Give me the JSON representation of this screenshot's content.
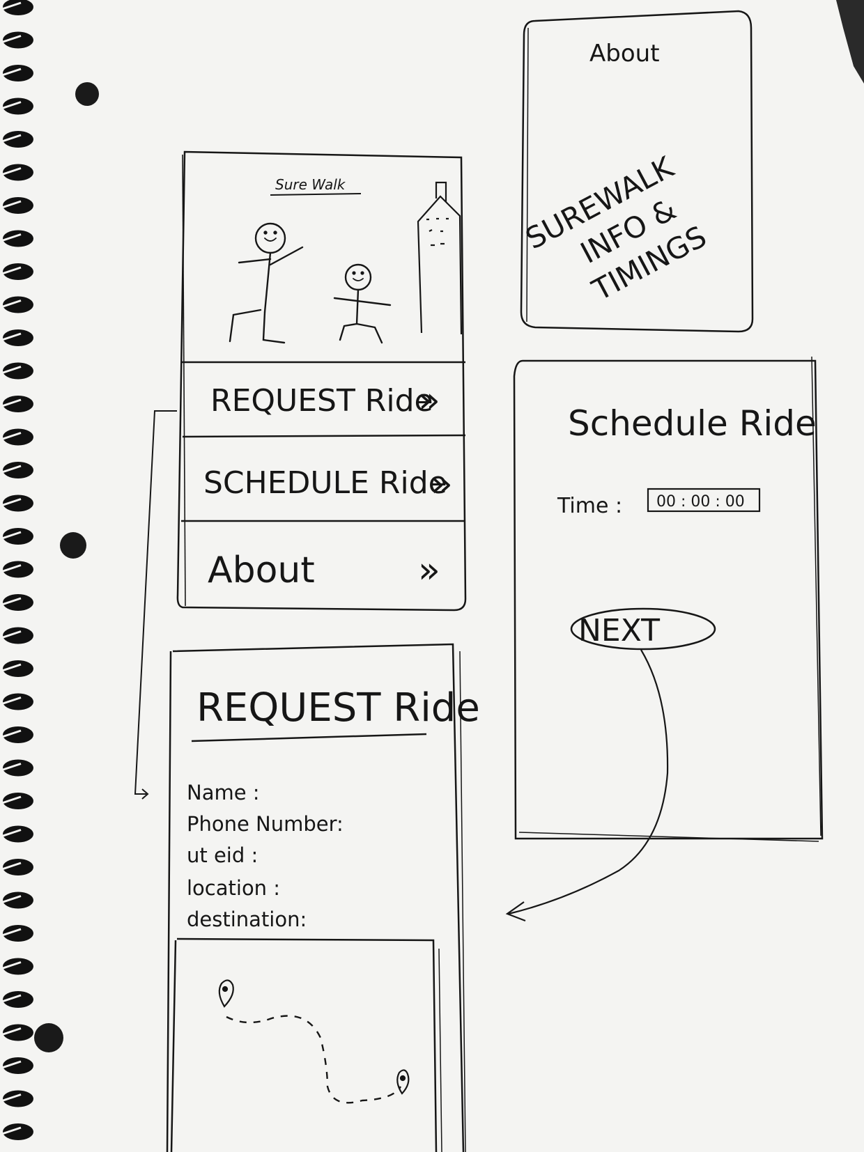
{
  "main_screen": {
    "app_title": "Sure Walk",
    "menu": [
      {
        "label": "REQUEST Ride",
        "chevron": "»"
      },
      {
        "label": "SCHEDULE Ride",
        "chevron": "»"
      },
      {
        "label": "About",
        "chevron": "»"
      }
    ]
  },
  "about_screen": {
    "title": "About",
    "content_lines": [
      "SUREWALK",
      "INFO &",
      "TIMINGS"
    ]
  },
  "schedule_screen": {
    "title": "Schedule Ride",
    "time_label": "Time :",
    "time_value": "00 : 00 : 00",
    "next_button": "NEXT"
  },
  "request_screen": {
    "title": "REQUEST Ride",
    "fields": [
      "Name :",
      "Phone Number:",
      "ut eid :",
      "location :",
      "destination:"
    ]
  },
  "icons": [
    "people-illustration",
    "tower-illustration",
    "map-pin-icon",
    "route-path",
    "flow-arrow"
  ]
}
